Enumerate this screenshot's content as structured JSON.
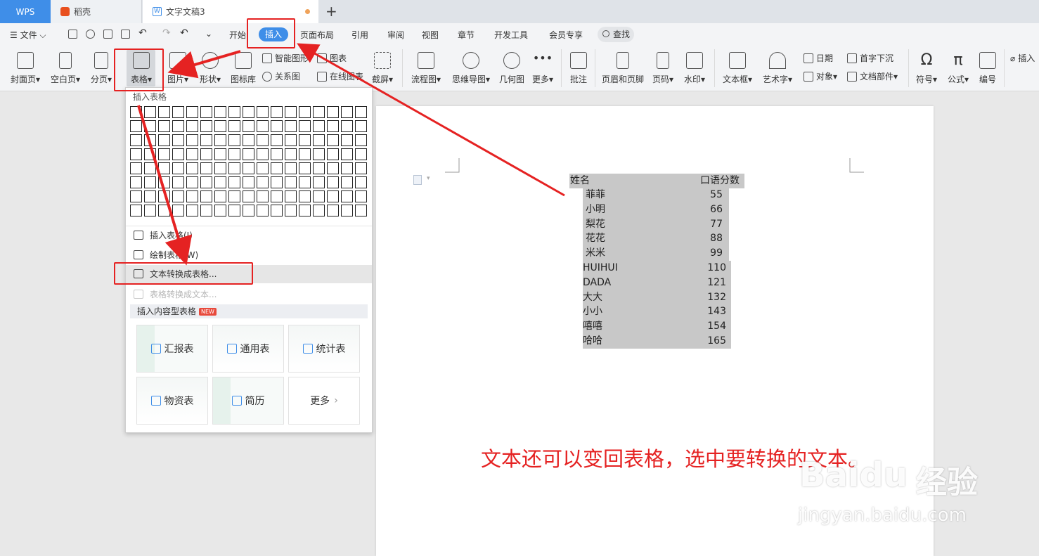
{
  "tabs": [
    {
      "label": "WPS"
    },
    {
      "label": "稻壳"
    },
    {
      "label": "文字文稿3"
    }
  ],
  "menubar": {
    "file": "文件",
    "items": [
      "开始",
      "插入",
      "页面布局",
      "引用",
      "审阅",
      "视图",
      "章节",
      "开发工具",
      "会员专享"
    ],
    "search": "查找"
  },
  "ribbon": {
    "cover": "封面页",
    "blank": "空白页",
    "pagebreak": "分页",
    "table": "表格",
    "picture": "图片",
    "shape": "形状",
    "iconlib": "图标库",
    "smartart": "智能图形",
    "chart": "图表",
    "relation": "关系图",
    "online": "在线图表",
    "screenshot": "截屏",
    "flowchart": "流程图",
    "mindmap": "思维导图",
    "geometry": "几何图",
    "more": "更多",
    "comment": "批注",
    "header_footer": "页眉和页脚",
    "page_number": "页码",
    "watermark": "水印",
    "textbox": "文本框",
    "wordart": "艺术字",
    "date": "日期",
    "object": "对象",
    "dropcap": "首字下沉",
    "docpart": "文档部件",
    "symbol": "符号",
    "formula": "公式",
    "numbering": "编号",
    "insert_attach": "插入"
  },
  "dropdown": {
    "title": "插入表格",
    "insert_table": "插入表格(I)",
    "draw_table": "绘制表格(W)",
    "text_to_table": "文本转换成表格...",
    "table_to_text": "表格转换成文本...",
    "content_tables": "插入内容型表格",
    "new_badge": "NEW",
    "cards": [
      "汇报表",
      "通用表",
      "统计表",
      "物资表",
      "简历",
      "更多"
    ]
  },
  "document": {
    "header": {
      "name": "姓名",
      "score": "口语分数"
    },
    "rows": [
      {
        "name": "菲菲",
        "score": "55"
      },
      {
        "name": "小明",
        "score": "66"
      },
      {
        "name": "梨花",
        "score": "77"
      },
      {
        "name": "花花",
        "score": "88"
      },
      {
        "name": "米米",
        "score": "99"
      },
      {
        "name": "HUIHUI",
        "score": "110"
      },
      {
        "name": "DADA",
        "score": "121"
      },
      {
        "name": "大大",
        "score": "132"
      },
      {
        "name": "小小",
        "score": "143"
      },
      {
        "name": "嘻嘻",
        "score": "154"
      },
      {
        "name": "哈哈",
        "score": "165"
      }
    ]
  },
  "caption": "文本还可以变回表格，选中要转换的文本。",
  "watermark": {
    "brand": "Baidu",
    "brand_cn": "经验",
    "url": "jingyan.baidu.com"
  },
  "colors": {
    "accent": "#3f8ee8",
    "annotation": "#e52222"
  }
}
